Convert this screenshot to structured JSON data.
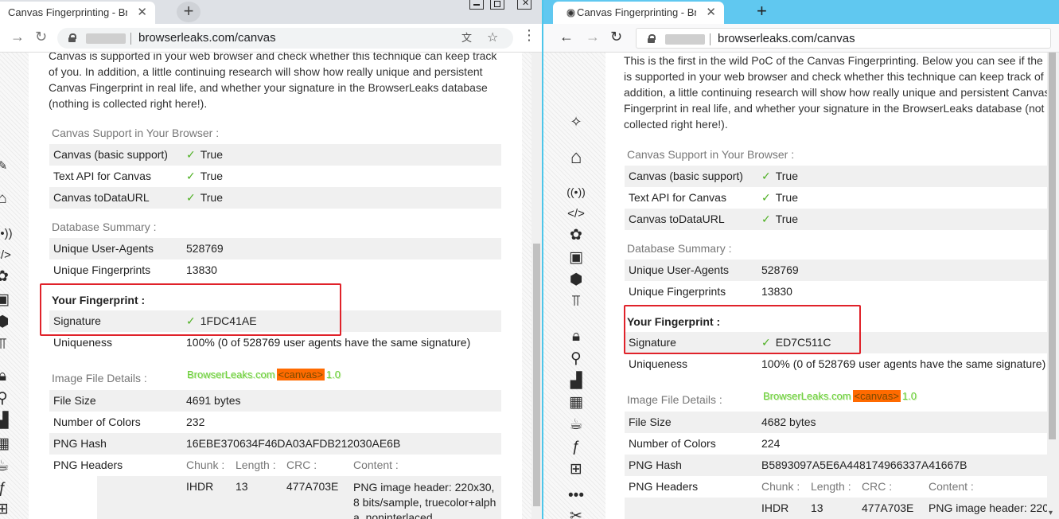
{
  "left": {
    "tab_title": "Canvas Fingerprinting - Browse",
    "close_glyph": "✕",
    "newtab_glyph": "+",
    "url": "browserleaks.com/canvas",
    "intro_lines": [
      "Canvas is supported in your web browser and check whether this technique can keep track",
      "of you. In addition, a little continuing research will show how really unique and persistent",
      "Canvas Fingerprint in real life, and whether your signature in the BrowserLeaks database",
      "(nothing is collected right here!)."
    ],
    "support_title": "Canvas Support in Your Browser :",
    "support": [
      {
        "k": "Canvas (basic support)",
        "v": "True"
      },
      {
        "k": "Text API for Canvas",
        "v": "True"
      },
      {
        "k": "Canvas toDataURL",
        "v": "True"
      }
    ],
    "db_title": "Database Summary :",
    "db": [
      {
        "k": "Unique User-Agents",
        "v": "528769"
      },
      {
        "k": "Unique Fingerprints",
        "v": "13830"
      }
    ],
    "fp_title": "Your Fingerprint :",
    "signature_label": "Signature",
    "signature": "1FDC41AE",
    "uniqueness_label": "Uniqueness",
    "uniqueness": "100% (0 of 528769 user agents have the same signature)",
    "image_title": "Image File Details :",
    "badge": {
      "a": "BrowserLeaks.com",
      "b": "<canvas>",
      "c": "1.0"
    },
    "file": [
      {
        "k": "File Size",
        "v": "4691 bytes"
      },
      {
        "k": "Number of Colors",
        "v": "232"
      },
      {
        "k": "PNG Hash",
        "v": "16EBE370634F46DA03AFDB212030AE6B"
      }
    ],
    "png_headers_label": "PNG Headers",
    "png_cols": [
      "Chunk :",
      "Length :",
      "CRC :",
      "Content :"
    ],
    "png_row": [
      "IHDR",
      "13",
      "477A703E"
    ],
    "png_content": [
      "PNG image header: 220x30,",
      "8 bits/sample, truecolor+alph",
      "a, noninterlaced"
    ]
  },
  "right": {
    "tab_title": "Canvas Fingerprinting - Browse",
    "close_glyph": "✕",
    "newtab_glyph": "+",
    "url": "browserleaks.com/canvas",
    "intro_lines": [
      "This is the first in the wild PoC of the Canvas Fingerprinting. Below you can see if the",
      "is supported in your web browser and check whether this technique can keep track of",
      "addition, a little continuing research will show how really unique and persistent Canvas",
      "Fingerprint in real life, and whether your signature in the BrowserLeaks database (not",
      "collected right here!)."
    ],
    "support_title": "Canvas Support in Your Browser :",
    "support": [
      {
        "k": "Canvas (basic support)",
        "v": "True"
      },
      {
        "k": "Text API for Canvas",
        "v": "True"
      },
      {
        "k": "Canvas toDataURL",
        "v": "True"
      }
    ],
    "db_title": "Database Summary :",
    "db": [
      {
        "k": "Unique User-Agents",
        "v": "528769"
      },
      {
        "k": "Unique Fingerprints",
        "v": "13830"
      }
    ],
    "fp_title": "Your Fingerprint :",
    "signature_label": "Signature",
    "signature": "ED7C511C",
    "uniqueness_label": "Uniqueness",
    "uniqueness": "100% (0 of 528769 user agents have the same signature)",
    "image_title": "Image File Details :",
    "badge": {
      "a": "BrowserLeaks.com",
      "b": "<canvas>",
      "c": "1.0"
    },
    "file": [
      {
        "k": "File Size",
        "v": "4682 bytes"
      },
      {
        "k": "Number of Colors",
        "v": "224"
      },
      {
        "k": "PNG Hash",
        "v": "B5893097A5E6A448174966337A41667B"
      }
    ],
    "png_headers_label": "PNG Headers",
    "png_cols": [
      "Chunk :",
      "Length :",
      "CRC :",
      "Content :"
    ],
    "png_row": [
      "IHDR",
      "13",
      "477A703E"
    ],
    "png_content": [
      "PNG image header: 220"
    ]
  },
  "check_glyph": "✓",
  "colors": {
    "accent_highlight": "#e0222a",
    "check": "#4caf20",
    "badge_orange": "#ff6a00",
    "firefox_tab": "#60c8f0"
  },
  "icons": [
    "tool-icon",
    "home-icon",
    "radio-icon",
    "code-icon",
    "flower-icon",
    "image-icon",
    "cube-icon",
    "text-height-icon",
    "lock-icon",
    "map-marker-icon",
    "signal-icon",
    "bricks-icon",
    "coffee-icon",
    "flash-icon",
    "windows-icon",
    "more-icon",
    "tools-icon"
  ]
}
